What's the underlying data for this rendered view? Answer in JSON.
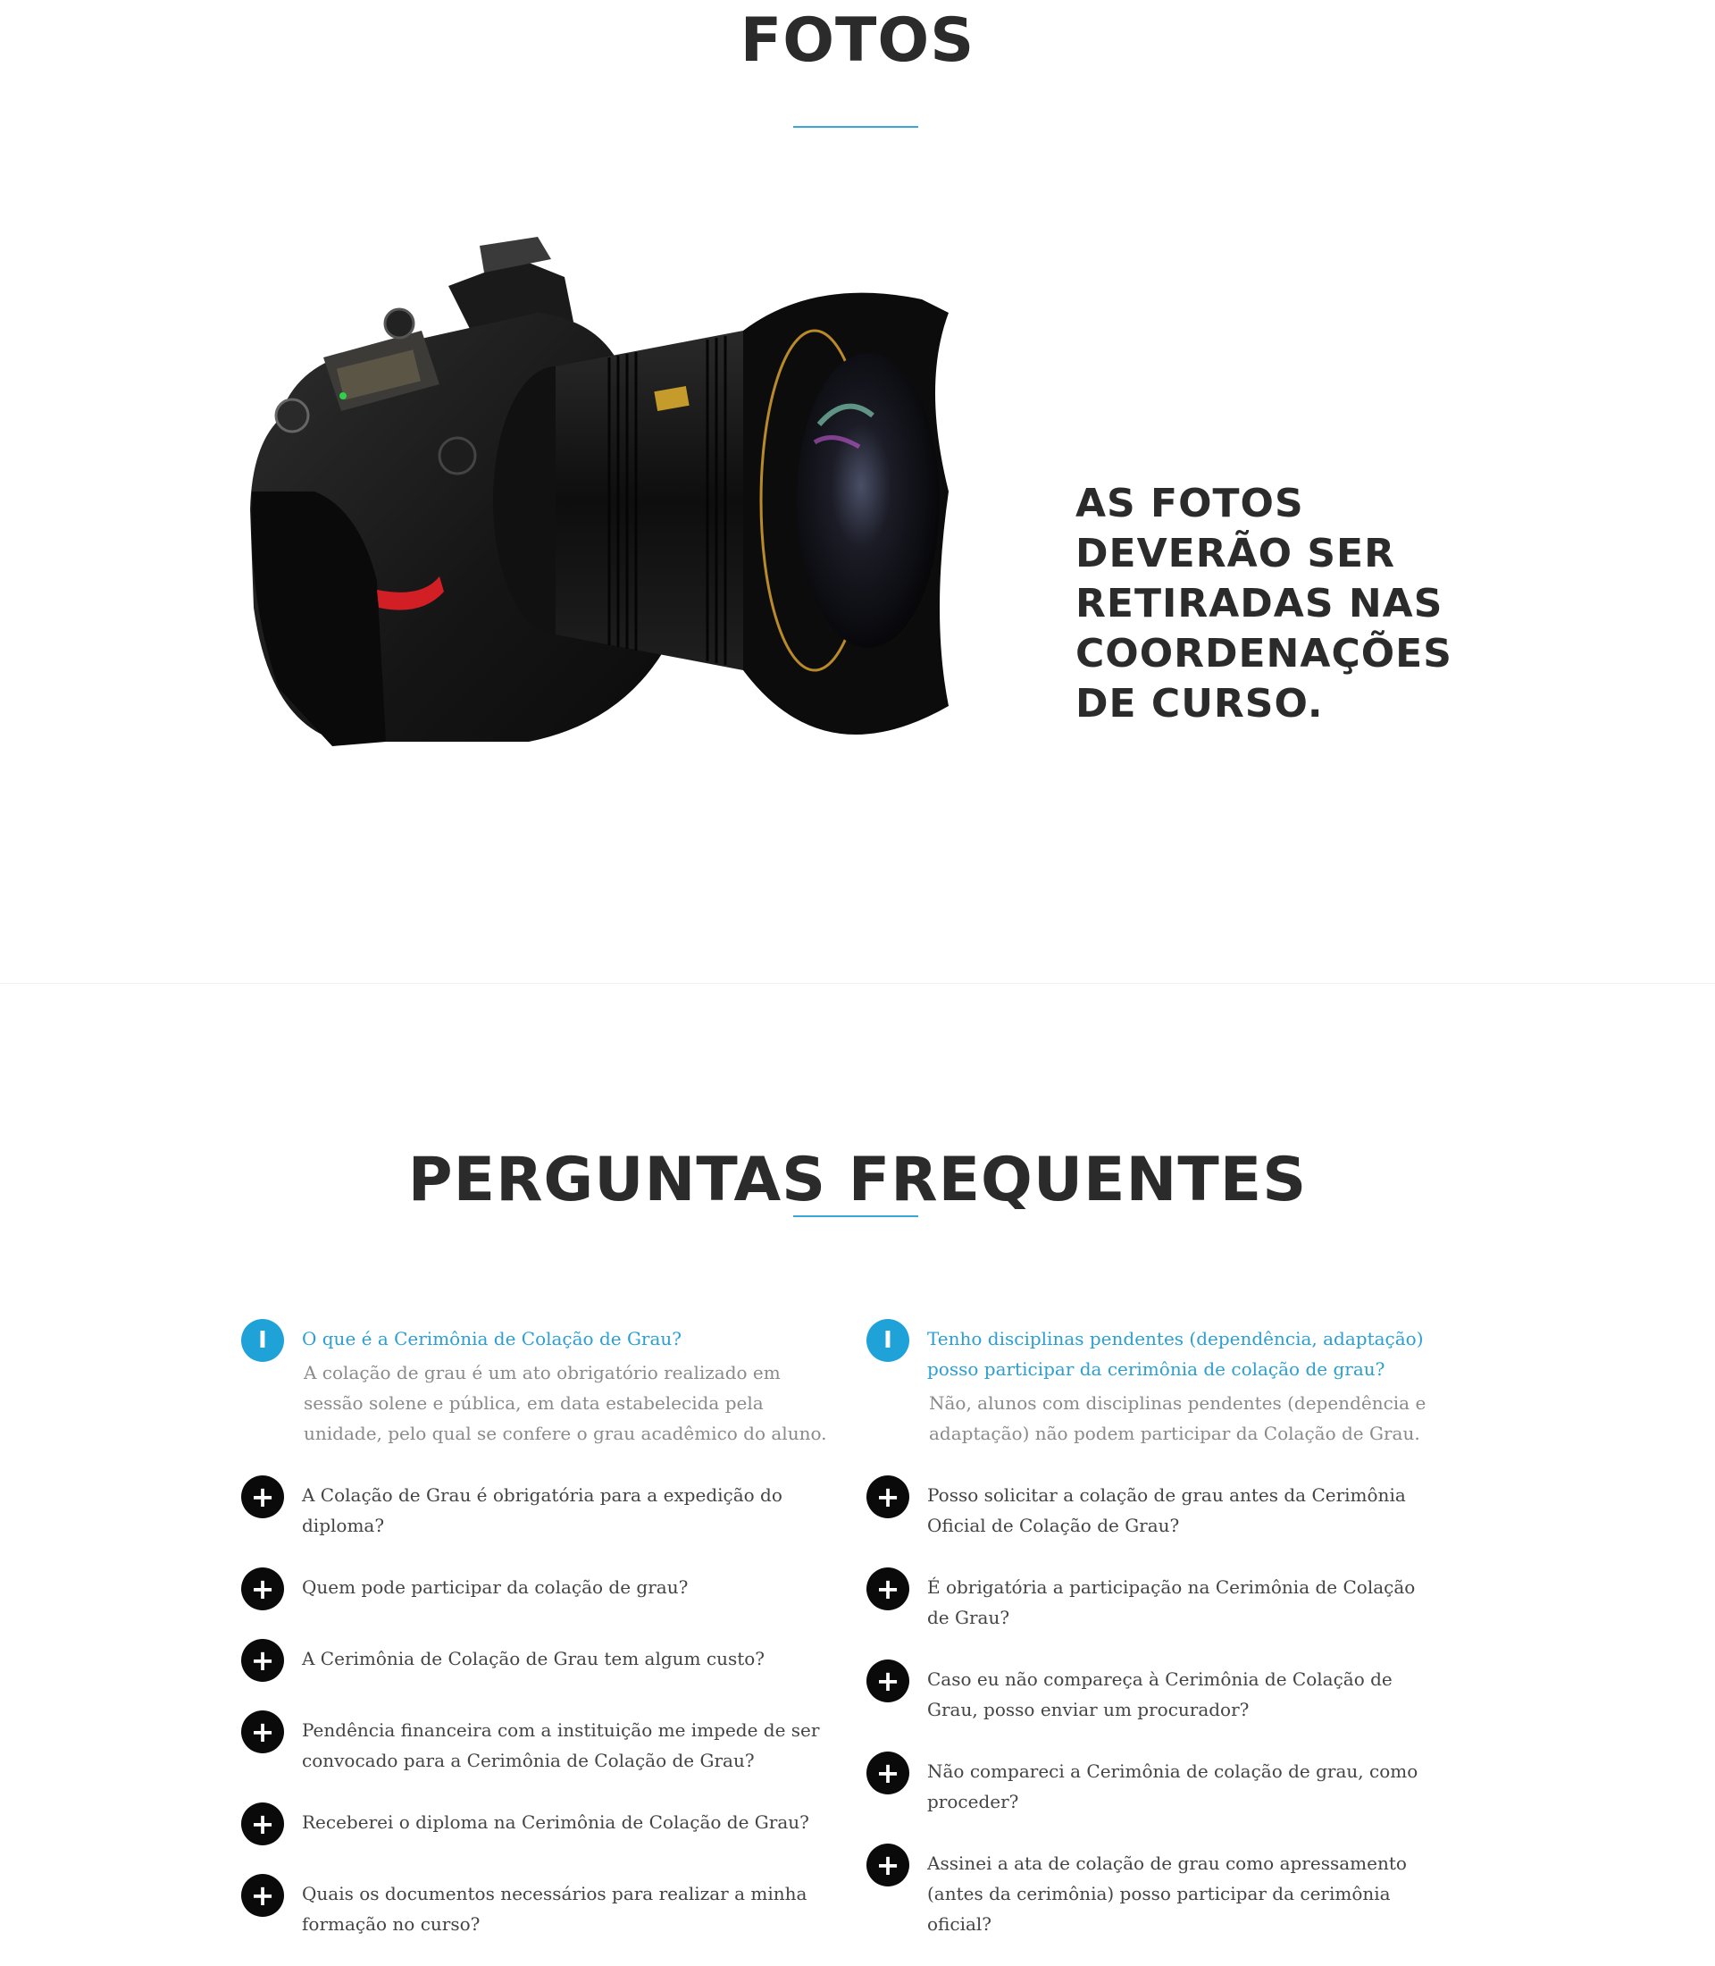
{
  "fotos": {
    "title": "FOTOS",
    "caption": "AS FOTOS DEVERÃO SER RETIRADAS NAS COORDENAÇÕES DE CURSO.",
    "accent_color": "#3aa7d8",
    "image": "camera-with-lens"
  },
  "faq": {
    "title": "PERGUNTAS FREQUENTES",
    "open_icon": "i-info-icon",
    "closed_icon": "plus-icon",
    "open_color": "#1fa2d8",
    "left": [
      {
        "q": "O que é a Cerimônia de Colação de Grau?",
        "a": "A colação de grau é um ato obrigatório realizado em sessão solene e pública, em data estabelecida pela unidade, pelo qual se confere o grau acadêmico do aluno.",
        "open": true
      },
      {
        "q": "A Colação de Grau é obrigatória para a expedição do diploma?"
      },
      {
        "q": "Quem pode participar da colação de grau?"
      },
      {
        "q": "A Cerimônia de Colação de Grau tem algum custo?"
      },
      {
        "q": "Pendência financeira com a instituição me impede de ser convocado para a Cerimônia de Colação de Grau?"
      },
      {
        "q": "Receberei o diploma na Cerimônia de Colação de Grau?"
      },
      {
        "q": "Quais os documentos necessários para realizar a minha formação no curso?"
      }
    ],
    "right": [
      {
        "q": "Tenho disciplinas pendentes (dependência, adaptação) posso participar da cerimônia de colação de grau?",
        "a": "Não, alunos com disciplinas pendentes (dependência e adaptação) não podem participar da Colação de Grau.",
        "open": true
      },
      {
        "q": "Posso solicitar a colação de grau antes da Cerimônia Oficial de Colação de Grau?"
      },
      {
        "q": "É obrigatória a participação na Cerimônia de Colação de Grau?"
      },
      {
        "q": "Caso eu não compareça à Cerimônia de Colação de Grau, posso enviar um procurador?"
      },
      {
        "q": "Não compareci a Cerimônia de colação de grau, como proceder?"
      },
      {
        "q": "Assinei a ata de colação de grau como apressamento (antes da cerimônia) posso participar da cerimônia oficial?"
      }
    ]
  }
}
